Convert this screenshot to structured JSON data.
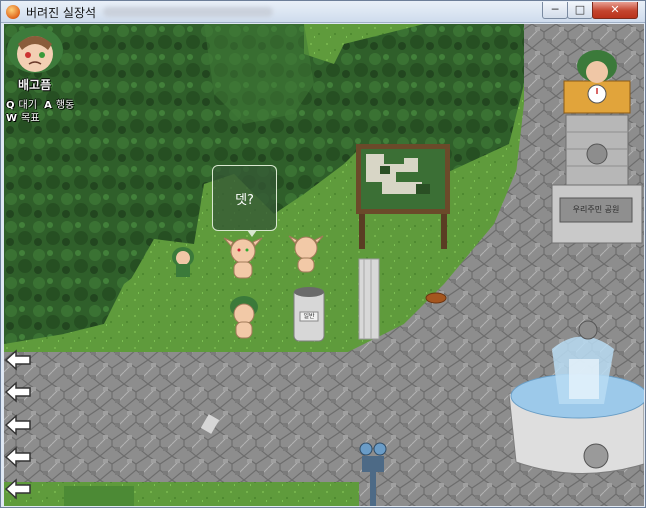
{
  "window": {
    "title": "버려진 실장석",
    "min_symbol": "─",
    "max_symbol": "□",
    "close_symbol": "✕"
  },
  "hud": {
    "status": "배고픔",
    "lines": [
      {
        "key": "Q",
        "label": "대기"
      },
      {
        "key": "A",
        "label": "행동"
      },
      {
        "key": "W",
        "label": "목표"
      }
    ]
  },
  "dialogue": {
    "text": "뎃?"
  },
  "trash_can": {
    "label": "일반"
  },
  "monument": {
    "plate": "우리주민 공원"
  },
  "nav": {
    "arrow_count": 5
  },
  "colors": {
    "grass": "#5f9b3c",
    "dark_tree": "#2c5a28",
    "path": "#8e8e8e",
    "water": "#8fc0e8"
  }
}
